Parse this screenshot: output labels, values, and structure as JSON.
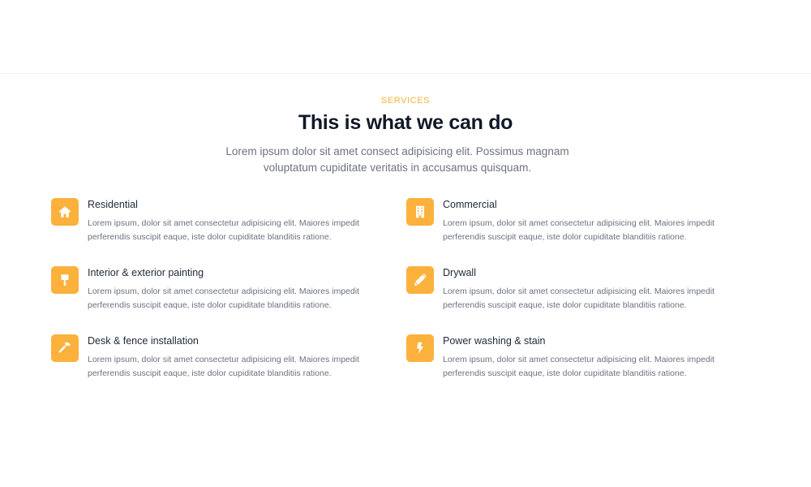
{
  "section": {
    "eyebrow": "SERVICES",
    "title": "This is what we can do",
    "intro": "Lorem ipsum dolor sit amet consect adipisicing elit. Possimus magnam voluptatum cupiditate veritatis in accusamus quisquam."
  },
  "colors": {
    "accent": "#fbb13c",
    "heading": "#111827",
    "muted": "#6b7280"
  },
  "services": [
    {
      "icon": "home-icon",
      "title": "Residential",
      "description": "Lorem ipsum, dolor sit amet consectetur adipisicing elit. Maiores impedit perferendis suscipit eaque, iste dolor cupiditate blanditiis ratione."
    },
    {
      "icon": "building-icon",
      "title": "Commercial",
      "description": "Lorem ipsum, dolor sit amet consectetur adipisicing elit. Maiores impedit perferendis suscipit eaque, iste dolor cupiditate blanditiis ratione."
    },
    {
      "icon": "paint-roller-icon",
      "title": "Interior & exterior painting",
      "description": "Lorem ipsum, dolor sit amet consectetur adipisicing elit. Maiores impedit perferendis suscipit eaque, iste dolor cupiditate blanditiis ratione."
    },
    {
      "icon": "pencil-icon",
      "title": "Drywall",
      "description": "Lorem ipsum, dolor sit amet consectetur adipisicing elit. Maiores impedit perferendis suscipit eaque, iste dolor cupiditate blanditiis ratione."
    },
    {
      "icon": "hammer-icon",
      "title": "Desk & fence installation",
      "description": "Lorem ipsum, dolor sit amet consectetur adipisicing elit. Maiores impedit perferendis suscipit eaque, iste dolor cupiditate blanditiis ratione."
    },
    {
      "icon": "bolt-icon",
      "title": "Power washing & stain",
      "description": "Lorem ipsum, dolor sit amet consectetur adipisicing elit. Maiores impedit perferendis suscipit eaque, iste dolor cupiditate blanditiis ratione."
    }
  ]
}
